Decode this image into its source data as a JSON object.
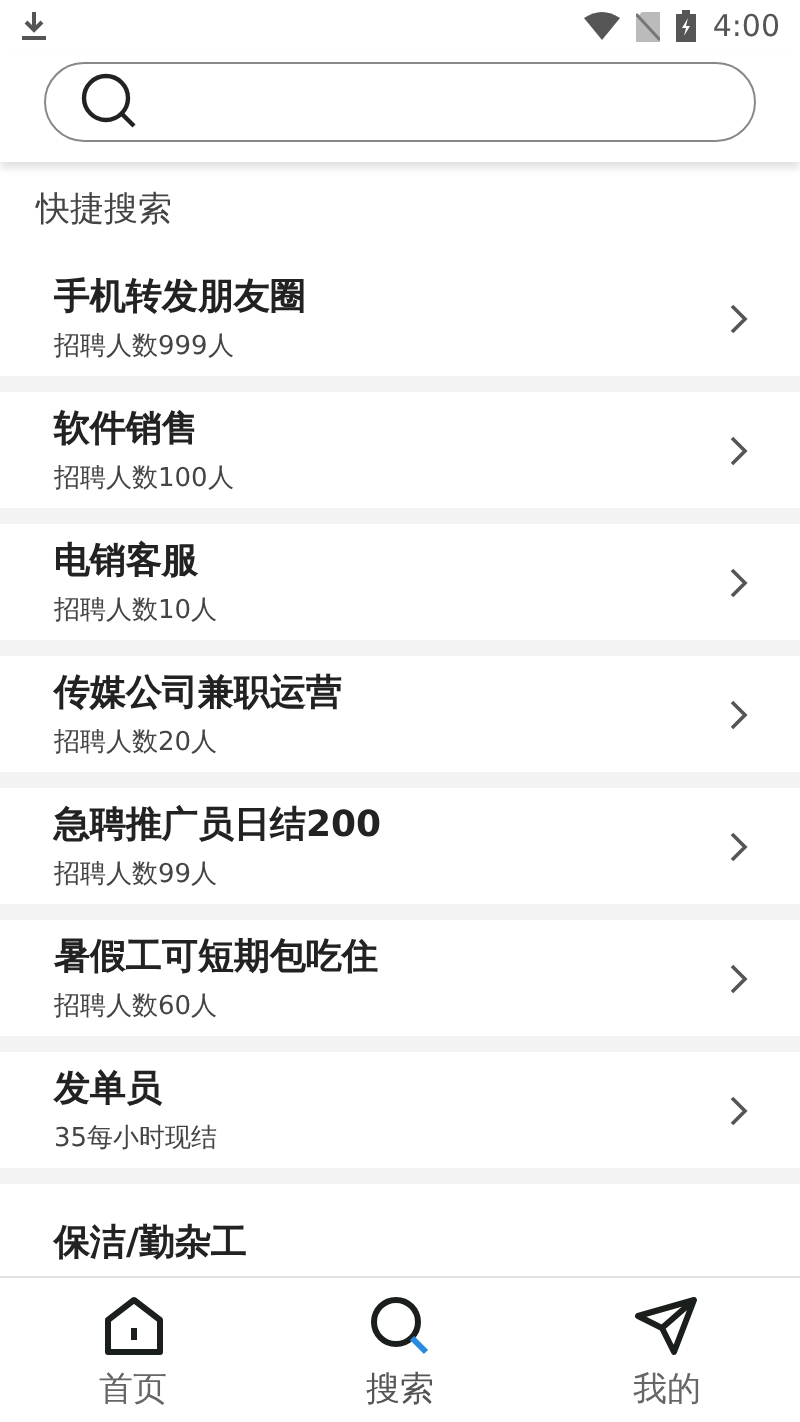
{
  "status_bar": {
    "time": "4:00"
  },
  "section_title": "快捷搜索",
  "jobs": [
    {
      "title": "手机转发朋友圈",
      "subtitle": "招聘人数999人"
    },
    {
      "title": "软件销售",
      "subtitle": "招聘人数100人"
    },
    {
      "title": "电销客服",
      "subtitle": "招聘人数10人"
    },
    {
      "title": "传媒公司兼职运营",
      "subtitle": "招聘人数20人"
    },
    {
      "title": "急聘推广员日结200",
      "subtitle": "招聘人数99人"
    },
    {
      "title": "暑假工可短期包吃住",
      "subtitle": "招聘人数60人"
    },
    {
      "title": "发单员",
      "subtitle": "35每小时现结"
    },
    {
      "title": "保洁/勤杂工"
    }
  ],
  "nav": [
    {
      "kind": "home",
      "label": "首页",
      "selected": false
    },
    {
      "kind": "search",
      "label": "搜索",
      "selected": true
    },
    {
      "kind": "send",
      "label": "我的",
      "selected": false
    }
  ]
}
